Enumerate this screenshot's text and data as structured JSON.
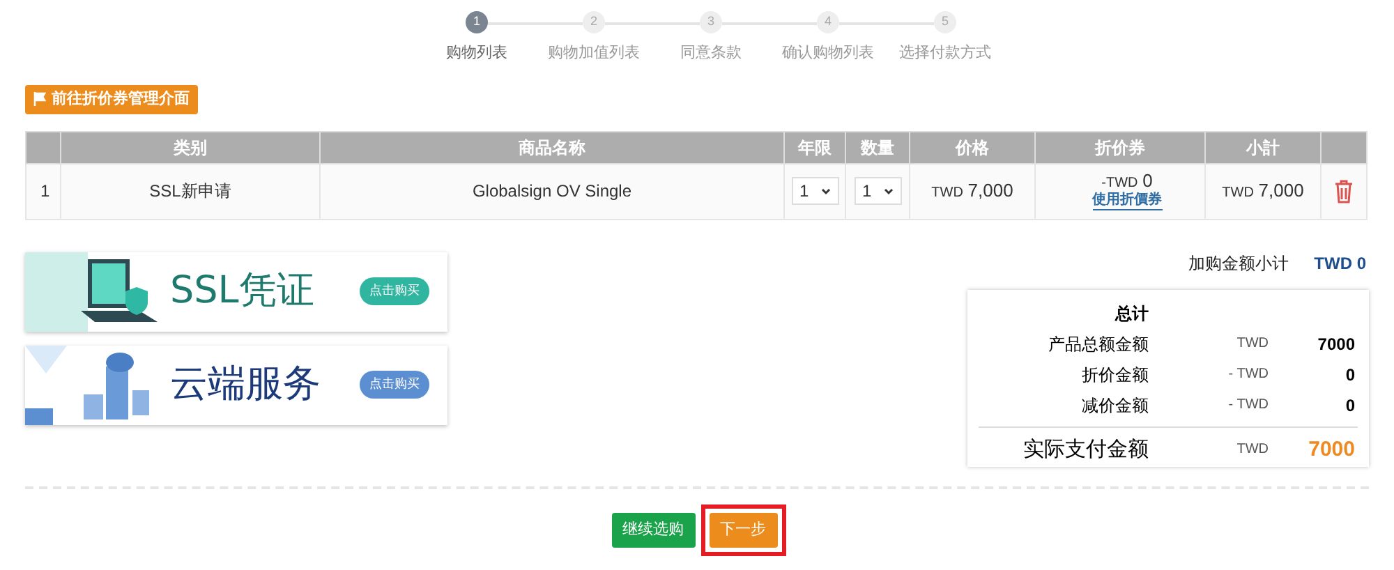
{
  "steps": [
    {
      "number": "1",
      "label": "购物列表",
      "selected": true
    },
    {
      "number": "2",
      "label": "购物加值列表",
      "selected": false
    },
    {
      "number": "3",
      "label": "同意条款",
      "selected": false
    },
    {
      "number": "4",
      "label": "确认购物列表",
      "selected": false
    },
    {
      "number": "5",
      "label": "选择付款方式",
      "selected": false
    }
  ],
  "coupon_button": "前往折价券管理介面",
  "table": {
    "columns": [
      "",
      "类别",
      "商品名称",
      "年限",
      "数量",
      "价格",
      "折价券",
      "小計",
      ""
    ],
    "rows": [
      {
        "index": "1",
        "category": "SSL新申请",
        "product": "Globalsign OV Single",
        "years": "1",
        "quantity": "1",
        "price_currency": "TWD",
        "price": "7,000",
        "discount_currency": "-TWD",
        "discount": "0",
        "coupon_link": "使用折價券",
        "subtotal_currency": "TWD",
        "subtotal": "7,000"
      }
    ]
  },
  "banners": [
    {
      "kind": "ssl",
      "title": "SSL凭证",
      "button": "点击购买"
    },
    {
      "kind": "cloud",
      "title": "云端服务",
      "button": "点击购买"
    }
  ],
  "addon_subtotal": {
    "label": "加购金额小计",
    "value": "TWD 0"
  },
  "summary": {
    "title": "总计",
    "lines": [
      {
        "label": "产品总额金额",
        "currency": "TWD",
        "value": "7000"
      },
      {
        "label": "折价金额",
        "currency": "- TWD",
        "value": "0"
      },
      {
        "label": "减价金额",
        "currency": "- TWD",
        "value": "0"
      }
    ],
    "total": {
      "label": "实际支付金额",
      "currency": "TWD",
      "value": "7000"
    }
  },
  "buttons": [
    {
      "label": "继续选购",
      "kind": "secondary",
      "focused": false
    },
    {
      "label": "下一步",
      "kind": "primary",
      "focused": true
    }
  ]
}
